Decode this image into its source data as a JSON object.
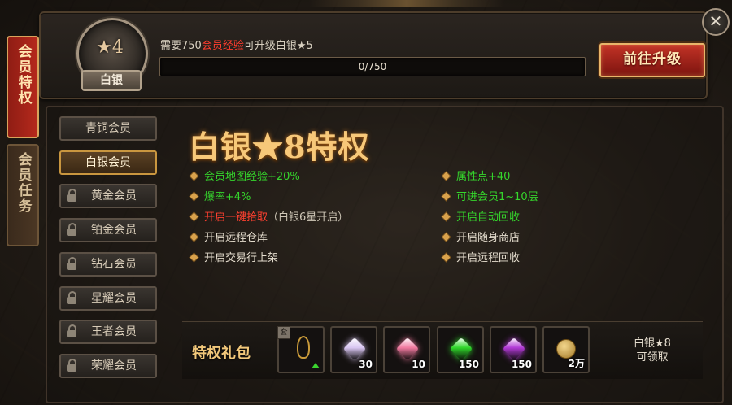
{
  "header": {
    "level_badge": "4",
    "level_star": "★",
    "tier_name": "白银",
    "need_prefix": "需要750",
    "need_highlight": "会员经验",
    "need_suffix": "可升级白银★5",
    "progress_text": "0/750",
    "progress_fraction": 0,
    "upgrade_label": "前往升级",
    "close_label": "✕"
  },
  "tabs": [
    {
      "label": "会员特权",
      "active": true
    },
    {
      "label": "会员任务",
      "active": false
    }
  ],
  "members": [
    {
      "label": "青铜会员",
      "locked": false,
      "selected": false
    },
    {
      "label": "白银会员",
      "locked": false,
      "selected": true
    },
    {
      "label": "黄金会员",
      "locked": true,
      "selected": false
    },
    {
      "label": "铂金会员",
      "locked": true,
      "selected": false
    },
    {
      "label": "钻石会员",
      "locked": true,
      "selected": false
    },
    {
      "label": "星耀会员",
      "locked": true,
      "selected": false
    },
    {
      "label": "王者会员",
      "locked": true,
      "selected": false
    },
    {
      "label": "荣耀会员",
      "locked": true,
      "selected": false
    }
  ],
  "privilege": {
    "title": "白银★8特权",
    "left_perks": [
      {
        "text": "会员地图经验+20%",
        "color": "green"
      },
      {
        "text": "爆率+4%",
        "color": "green"
      },
      {
        "text": "开启一键拾取",
        "suffix": "（白银6星开启）",
        "color": "red"
      },
      {
        "text": "开启远程仓库",
        "color": "white"
      },
      {
        "text": "开启交易行上架",
        "color": "white"
      }
    ],
    "right_perks": [
      {
        "text": "属性点+40",
        "color": "green"
      },
      {
        "text": "可进会员1~10层",
        "color": "green"
      },
      {
        "text": "开启自动回收",
        "color": "green"
      },
      {
        "text": "开启随身商店",
        "color": "white"
      },
      {
        "text": "开启远程回收",
        "color": "white"
      }
    ]
  },
  "gift": {
    "title": "特权礼包",
    "tag": "套",
    "items": [
      {
        "icon": "lamp-icon",
        "count": ""
      },
      {
        "icon": "purple-diamond-icon",
        "count": "30",
        "color": "#d9c6f2"
      },
      {
        "icon": "pink-gem-icon",
        "count": "10",
        "color": "#f17aa0"
      },
      {
        "icon": "green-gem-icon",
        "count": "150",
        "color": "#2fd62a"
      },
      {
        "icon": "purple-gem-icon",
        "count": "150",
        "color": "#b23ad6"
      },
      {
        "icon": "gold-coin-icon",
        "count": "2万"
      }
    ],
    "claim_line1": "白银★8",
    "claim_line2": "可领取"
  }
}
